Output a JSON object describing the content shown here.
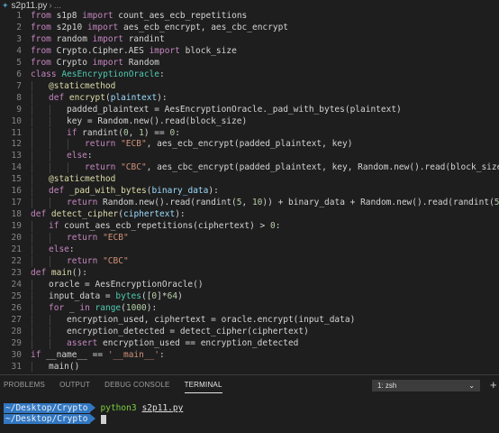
{
  "breadcrumb": {
    "file": "s2p11.py",
    "separator": "›",
    "ellipsis": "..."
  },
  "colors": {
    "keyword": "#c586c0",
    "default": "#d4d4d4",
    "function": "#dcdcaa",
    "string": "#ce9178",
    "number": "#b5cea8",
    "decorator": "#dcdcaa",
    "param": "#9cdcfe",
    "class": "#4ec9b0"
  },
  "editor": {
    "lines": [
      {
        "n": "1",
        "indent": 0,
        "tokens": [
          [
            "kw",
            "from"
          ],
          [
            "d",
            " s1p8 "
          ],
          [
            "kw",
            "import"
          ],
          [
            "d",
            " count_aes_ecb_repetitions"
          ]
        ]
      },
      {
        "n": "2",
        "indent": 0,
        "tokens": [
          [
            "kw",
            "from"
          ],
          [
            "d",
            " s2p10 "
          ],
          [
            "kw",
            "import"
          ],
          [
            "d",
            " aes_ecb_encrypt, aes_cbc_encrypt"
          ]
        ]
      },
      {
        "n": "3",
        "indent": 0,
        "tokens": [
          [
            "kw",
            "from"
          ],
          [
            "d",
            " random "
          ],
          [
            "kw",
            "import"
          ],
          [
            "d",
            " randint"
          ]
        ]
      },
      {
        "n": "4",
        "indent": 0,
        "tokens": [
          [
            "kw",
            "from"
          ],
          [
            "d",
            " Crypto.Cipher.AES "
          ],
          [
            "kw",
            "import"
          ],
          [
            "d",
            " block_size"
          ]
        ]
      },
      {
        "n": "5",
        "indent": 0,
        "tokens": [
          [
            "kw",
            "from"
          ],
          [
            "d",
            " Crypto "
          ],
          [
            "kw",
            "import"
          ],
          [
            "d",
            " Random"
          ]
        ]
      },
      {
        "n": "6",
        "indent": 0,
        "tokens": [
          [
            "kw",
            "class"
          ],
          [
            "d",
            " "
          ],
          [
            "cls",
            "AesEncryptionOracle"
          ],
          [
            "d",
            ":"
          ]
        ]
      },
      {
        "n": "7",
        "indent": 1,
        "tokens": [
          [
            "dec",
            "@staticmethod"
          ]
        ]
      },
      {
        "n": "8",
        "indent": 1,
        "tokens": [
          [
            "kw",
            "def"
          ],
          [
            "d",
            " "
          ],
          [
            "fn",
            "encrypt"
          ],
          [
            "d",
            "("
          ],
          [
            "par",
            "plaintext"
          ],
          [
            "d",
            "):"
          ]
        ]
      },
      {
        "n": "9",
        "indent": 2,
        "tokens": [
          [
            "d",
            "padded_plaintext = AesEncryptionOracle._pad_with_bytes(plaintext)"
          ]
        ]
      },
      {
        "n": "10",
        "indent": 2,
        "tokens": [
          [
            "d",
            "key = Random.new().read(block_size)"
          ]
        ]
      },
      {
        "n": "11",
        "indent": 2,
        "tokens": [
          [
            "kw",
            "if"
          ],
          [
            "d",
            " randint("
          ],
          [
            "num",
            "0"
          ],
          [
            "d",
            ", "
          ],
          [
            "num",
            "1"
          ],
          [
            "d",
            ") == "
          ],
          [
            "num",
            "0"
          ],
          [
            "d",
            ":"
          ]
        ]
      },
      {
        "n": "12",
        "indent": 3,
        "tokens": [
          [
            "kw",
            "return"
          ],
          [
            "d",
            " "
          ],
          [
            "str",
            "\"ECB\""
          ],
          [
            "d",
            ", aes_ecb_encrypt(padded_plaintext, key)"
          ]
        ]
      },
      {
        "n": "13",
        "indent": 2,
        "tokens": [
          [
            "kw",
            "else"
          ],
          [
            "d",
            ":"
          ]
        ]
      },
      {
        "n": "14",
        "indent": 3,
        "tokens": [
          [
            "kw",
            "return"
          ],
          [
            "d",
            " "
          ],
          [
            "str",
            "\"CBC\""
          ],
          [
            "d",
            ", aes_cbc_encrypt(padded_plaintext, key, Random.new().read(block_size))"
          ]
        ]
      },
      {
        "n": "15",
        "indent": 1,
        "tokens": [
          [
            "dec",
            "@staticmethod"
          ]
        ]
      },
      {
        "n": "16",
        "indent": 1,
        "tokens": [
          [
            "kw",
            "def"
          ],
          [
            "d",
            " "
          ],
          [
            "fn",
            "_pad_with_bytes"
          ],
          [
            "d",
            "("
          ],
          [
            "par",
            "binary_data"
          ],
          [
            "d",
            "):"
          ]
        ]
      },
      {
        "n": "17",
        "indent": 2,
        "tokens": [
          [
            "kw",
            "return"
          ],
          [
            "d",
            " Random.new().read(randint("
          ],
          [
            "num",
            "5"
          ],
          [
            "d",
            ", "
          ],
          [
            "num",
            "10"
          ],
          [
            "d",
            ")) + binary_data + Random.new().read(randint("
          ],
          [
            "num",
            "5"
          ],
          [
            "d",
            ", "
          ],
          [
            "num",
            "10"
          ],
          [
            "d",
            "))"
          ]
        ]
      },
      {
        "n": "18",
        "indent": 0,
        "tokens": [
          [
            "kw",
            "def"
          ],
          [
            "d",
            " "
          ],
          [
            "fn",
            "detect_cipher"
          ],
          [
            "d",
            "("
          ],
          [
            "par",
            "ciphertext"
          ],
          [
            "d",
            "):"
          ]
        ]
      },
      {
        "n": "19",
        "indent": 1,
        "tokens": [
          [
            "kw",
            "if"
          ],
          [
            "d",
            " count_aes_ecb_repetitions(ciphertext) > "
          ],
          [
            "num",
            "0"
          ],
          [
            "d",
            ":"
          ]
        ]
      },
      {
        "n": "20",
        "indent": 2,
        "tokens": [
          [
            "kw",
            "return"
          ],
          [
            "d",
            " "
          ],
          [
            "str",
            "\"ECB\""
          ]
        ]
      },
      {
        "n": "21",
        "indent": 1,
        "tokens": [
          [
            "kw",
            "else"
          ],
          [
            "d",
            ":"
          ]
        ]
      },
      {
        "n": "22",
        "indent": 2,
        "tokens": [
          [
            "kw",
            "return"
          ],
          [
            "d",
            " "
          ],
          [
            "str",
            "\"CBC\""
          ]
        ]
      },
      {
        "n": "23",
        "indent": 0,
        "tokens": [
          [
            "kw",
            "def"
          ],
          [
            "d",
            " "
          ],
          [
            "fn",
            "main"
          ],
          [
            "d",
            "():"
          ]
        ]
      },
      {
        "n": "24",
        "indent": 1,
        "tokens": [
          [
            "d",
            "oracle = AesEncryptionOracle()"
          ]
        ]
      },
      {
        "n": "25",
        "indent": 1,
        "tokens": [
          [
            "d",
            "input_data = "
          ],
          [
            "cls",
            "bytes"
          ],
          [
            "d",
            "(["
          ],
          [
            "num",
            "0"
          ],
          [
            "d",
            "]*"
          ],
          [
            "num",
            "64"
          ],
          [
            "d",
            ")"
          ]
        ]
      },
      {
        "n": "26",
        "indent": 1,
        "tokens": [
          [
            "kw",
            "for"
          ],
          [
            "d",
            " _ "
          ],
          [
            "kw",
            "in"
          ],
          [
            "d",
            " "
          ],
          [
            "cls",
            "range"
          ],
          [
            "d",
            "("
          ],
          [
            "num",
            "1000"
          ],
          [
            "d",
            "):"
          ]
        ]
      },
      {
        "n": "27",
        "indent": 2,
        "tokens": [
          [
            "d",
            "encryption_used, ciphertext = oracle.encrypt(input_data)"
          ]
        ]
      },
      {
        "n": "28",
        "indent": 2,
        "tokens": [
          [
            "d",
            "encryption_detected = detect_cipher(ciphertext)"
          ]
        ]
      },
      {
        "n": "29",
        "indent": 2,
        "tokens": [
          [
            "kw",
            "assert"
          ],
          [
            "d",
            " encryption_used == encryption_detected"
          ]
        ]
      },
      {
        "n": "30",
        "indent": 0,
        "tokens": [
          [
            "kw",
            "if"
          ],
          [
            "d",
            " __name__ == "
          ],
          [
            "str",
            "'__main__'"
          ],
          [
            "d",
            ":"
          ]
        ]
      },
      {
        "n": "31",
        "indent": 1,
        "tokens": [
          [
            "d",
            "main()"
          ]
        ]
      },
      {
        "n": "32",
        "indent": 0,
        "tokens": []
      }
    ]
  },
  "panel": {
    "tabs": [
      {
        "label": "PROBLEMS",
        "active": false
      },
      {
        "label": "OUTPUT",
        "active": false
      },
      {
        "label": "DEBUG CONSOLE",
        "active": false
      },
      {
        "label": "TERMINAL",
        "active": true
      }
    ],
    "terminal_select": "1: zsh",
    "add_terminal": "+",
    "terminal_lines": [
      {
        "path": "~/Desktop/Crypto",
        "command": "python3",
        "arg": "s2p11.py",
        "cursor": false
      },
      {
        "path": "~/Desktop/Crypto",
        "command": "",
        "arg": "",
        "cursor": true
      }
    ]
  }
}
